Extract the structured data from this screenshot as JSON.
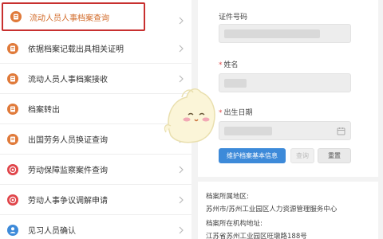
{
  "menu": {
    "items": [
      {
        "label": "流动人员人事档案查询",
        "icon": "doc-icon",
        "icon_color": "#e07a3a",
        "highlighted": true
      },
      {
        "label": "依据档案记载出具相关证明",
        "icon": "doc-icon",
        "icon_color": "#e07a3a"
      },
      {
        "label": "流动人员人事档案接收",
        "icon": "doc-icon",
        "icon_color": "#e07a3a"
      },
      {
        "label": "档案转出",
        "icon": "doc-icon",
        "icon_color": "#e07a3a"
      },
      {
        "label": "出国劳务人员换证查询",
        "icon": "doc-icon",
        "icon_color": "#e07a3a"
      },
      {
        "label": "劳动保障监察案件查询",
        "icon": "target-icon",
        "icon_color": "#e0454a"
      },
      {
        "label": "劳动人事争议调解申请",
        "icon": "target-icon",
        "icon_color": "#e0454a"
      },
      {
        "label": "见习人员确认",
        "icon": "user-icon",
        "icon_color": "#3d8ad9"
      }
    ]
  },
  "form": {
    "id_label": "证件号码",
    "name_label": "姓名",
    "dob_label": "出生日期",
    "required_mark": "*"
  },
  "buttons": {
    "maintain": "维护档案基本信息",
    "search": "查询",
    "reset": "重置"
  },
  "info": {
    "region_label": "档案所属地区:",
    "region_value": "苏州市/苏州工业园区人力资源管理服务中心",
    "address_label": "档案所在机构地址:",
    "address_value": "江苏省苏州工业园区旺墩路188号"
  },
  "colors": {
    "highlight_border": "#c8302f",
    "primary": "#3d8ad9",
    "orange_icon": "#e07a3a",
    "red_icon": "#e0454a"
  }
}
